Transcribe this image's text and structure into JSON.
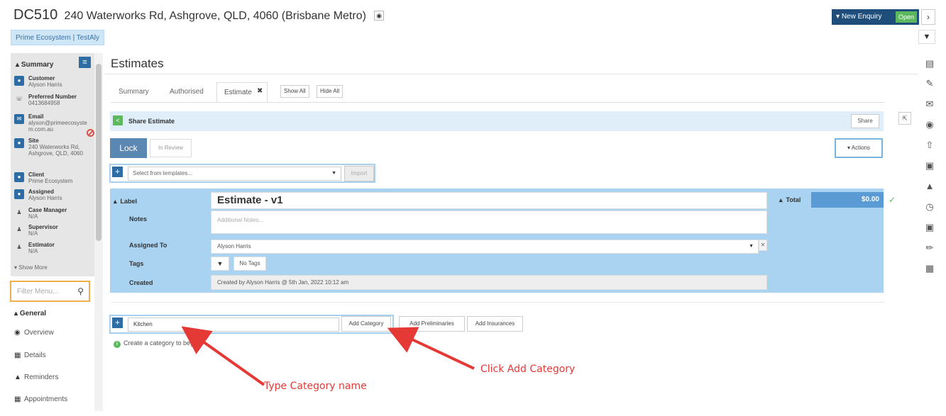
{
  "header": {
    "code": "DC510",
    "address": "240 Waterworks Rd, Ashgrove, QLD, 4060 (Brisbane Metro)",
    "ecosystem_badge": "Prime Ecosystem | TestAly",
    "enquiry_button": "New Enquiry",
    "enquiry_status": "Open"
  },
  "sidebar": {
    "summary_title": "Summary",
    "items": [
      {
        "label": "Customer",
        "value": "Alyson Harris",
        "icon": "user-icon"
      },
      {
        "label": "Preferred Number",
        "value": "0413684958",
        "icon": "phone-icon"
      },
      {
        "label": "Email",
        "value": "alyson@primeecosystem.com.au",
        "icon": "envelope-icon"
      },
      {
        "label": "Site",
        "value": "240 Waterworks Rd, Ashgrove, QLD, 4060",
        "icon": "map-pin-icon"
      },
      {
        "label": "Client",
        "value": "Prime Ecosystem",
        "icon": "user-icon"
      },
      {
        "label": "Assigned",
        "value": "Alyson Harris",
        "icon": "user-icon"
      },
      {
        "label": "Case Manager",
        "value": "N/A",
        "icon": "person-icon"
      },
      {
        "label": "Supervisor",
        "value": "N/A",
        "icon": "person-icon"
      },
      {
        "label": "Estimator",
        "value": "N/A",
        "icon": "person-icon"
      }
    ],
    "show_more": "Show More",
    "filter_placeholder": "Filter Menu...",
    "general_title": "General",
    "nav": [
      "Overview",
      "Details",
      "Reminders",
      "Appointments"
    ]
  },
  "main": {
    "title": "Estimates",
    "tabs": [
      "Summary",
      "Authorised",
      "Estimate"
    ],
    "show_all": "Show All",
    "hide_all": "Hide All",
    "share_section": "Share Estimate",
    "share_button": "Share",
    "lock_button": "Lock",
    "review_button": "In Review",
    "actions_button": "Actions",
    "template_placeholder": "Select from templates...",
    "import_button": "Import",
    "estimate": {
      "label_heading": "Label",
      "name": "Estimate - v1",
      "notes_label": "Notes",
      "notes_placeholder": "Additional Notes...",
      "assigned_label": "Assigned To",
      "assigned_value": "Alyson Harris",
      "tags_label": "Tags",
      "tags_value": "No Tags",
      "created_label": "Created",
      "created_value": "Created by Alyson Harris @ 5th Jan, 2022 10:12 am",
      "total_label": "Total",
      "total_value": "$0.00"
    },
    "category": {
      "input_value": "Kitchen",
      "add_category": "Add Category",
      "add_preliminaries": "Add Preliminaries",
      "add_insurances": "Add Insurances",
      "info": "Create a category to beg"
    }
  },
  "annotations": {
    "type_name": "Type Category name",
    "click_add": "Click Add Category",
    "color": "#e53935"
  },
  "colors": {
    "primary": "#2e6da4",
    "panel_blue": "#a9d3f0",
    "total_blue": "#5b9bd5",
    "success": "#5cb85c"
  }
}
